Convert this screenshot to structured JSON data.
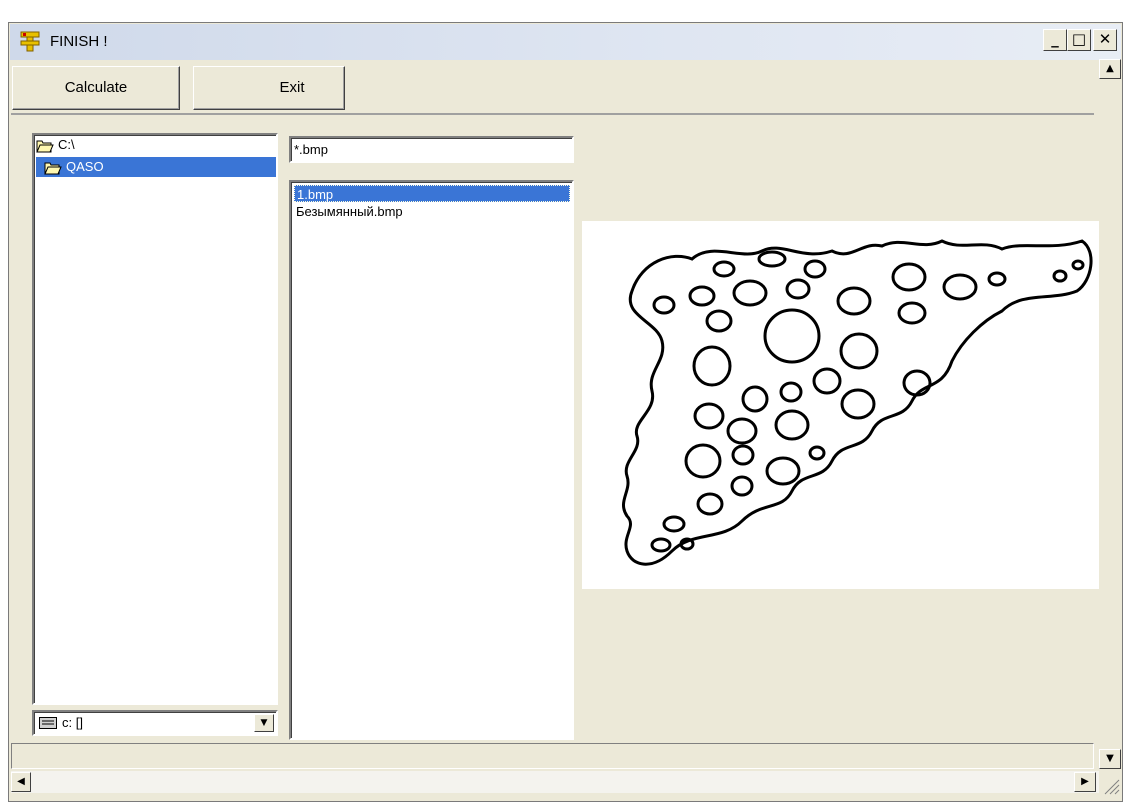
{
  "window": {
    "title": "FINISH !"
  },
  "titlebar": {
    "min_label": "_",
    "max_label": "□",
    "close_label": "✕"
  },
  "toolbar": {
    "calculate_label": "Calculate",
    "exit_label": "Exit"
  },
  "dir_tree": {
    "items": [
      {
        "label": "C:\\",
        "selected": false
      },
      {
        "label": "QASO",
        "selected": true
      }
    ]
  },
  "drive": {
    "label": "c: []"
  },
  "filter": {
    "value": "*.bmp"
  },
  "files": {
    "items": [
      {
        "label": "1.bmp",
        "selected": true
      },
      {
        "label": "Безымянный.bmp",
        "selected": false
      }
    ]
  },
  "colors": {
    "selection": "#3a75d6",
    "face": "#ece9d8"
  },
  "icons": [
    "app-icon",
    "folder-open-icon",
    "drive-icon",
    "dropdown-arrow-icon",
    "scroll-up-icon",
    "scroll-down-icon",
    "scroll-left-icon",
    "scroll-right-icon",
    "resize-grip-icon"
  ]
}
